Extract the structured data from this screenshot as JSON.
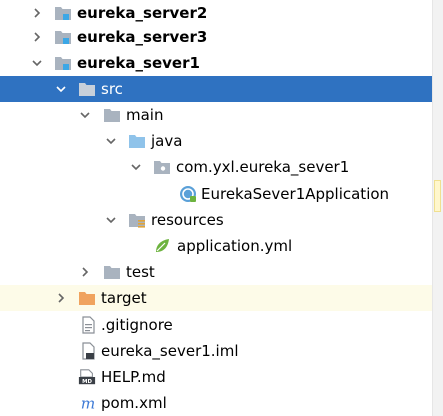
{
  "tree": {
    "items": [
      {
        "label": "eureka_server2"
      },
      {
        "label": "eureka_server3"
      },
      {
        "label": "eureka_sever1"
      },
      {
        "label": "src"
      },
      {
        "label": "main"
      },
      {
        "label": "java"
      },
      {
        "label": "com.yxl.eureka_sever1"
      },
      {
        "label": "EurekaSever1Application"
      },
      {
        "label": "resources"
      },
      {
        "label": "application.yml"
      },
      {
        "label": "test"
      },
      {
        "label": "target"
      },
      {
        "label": ".gitignore"
      },
      {
        "label": "eureka_sever1.iml"
      },
      {
        "label": "HELP.md"
      },
      {
        "label": "pom.xml"
      }
    ]
  },
  "colors": {
    "selection": "#2f72c1",
    "folder": "#a9b3bf",
    "source_folder": "#8fc3ea",
    "excluded_folder": "#f0a35e",
    "module_badge": "#3ba7e6",
    "ignored_row": "#fdfbe8",
    "spring_green": "#6db33f",
    "maven_blue": "#3d7ad6"
  }
}
